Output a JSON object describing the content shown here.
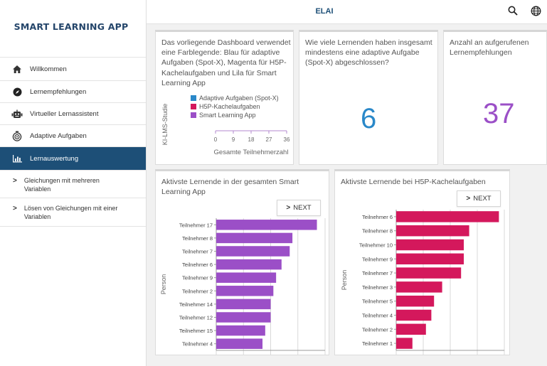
{
  "app_title": "SMART LEARNING APP",
  "topbar": {
    "title": "ELAI"
  },
  "nav": [
    {
      "label": "Willkommen",
      "icon": "home-icon",
      "active": false
    },
    {
      "label": "Lernempfehlungen",
      "icon": "compass-icon",
      "active": false
    },
    {
      "label": "Virtueller Lernassistent",
      "icon": "robot-icon",
      "active": false
    },
    {
      "label": "Adaptive Aufgaben",
      "icon": "target-icon",
      "active": false
    },
    {
      "label": "Lernauswertung",
      "icon": "bar-chart-icon",
      "active": true
    }
  ],
  "subnav": [
    {
      "label": "Gleichungen mit mehreren Variablen"
    },
    {
      "label": "Lösen von Gleichungen mit einer Variablen"
    }
  ],
  "card1": {
    "text": "Das vorliegende Dashboard verwendet eine Farblegende: Blau für adaptive Aufgaben (Spot-X), Magenta für H5P-Kachelaufgaben und Lila für Smart Learning App",
    "legend": [
      {
        "label": "Adaptive Aufgaben (Spot-X)",
        "color": "#2a88c9"
      },
      {
        "label": "H5P-Kachelaufgaben",
        "color": "#d4185c"
      },
      {
        "label": "Smart Learning App",
        "color": "#9b4fc7"
      }
    ],
    "ylabel": "KI-LMS-Studie",
    "xlabel": "Gesamte Teilnehmerzahl",
    "ticks": [
      "0",
      "9",
      "18",
      "27",
      "36"
    ]
  },
  "card2": {
    "text": "Wie viele Lernenden haben insgesamt mindestens eine adaptive Aufgabe (Spot-X) abgeschlossen?",
    "value": "6",
    "color": "#2a88c9"
  },
  "card3": {
    "text": "Anzahl an aufgerufenen Lernempfehlungen",
    "value": "37",
    "color": "#9b4fc7"
  },
  "chart_panel1": {
    "title": "Aktivste Lernende in der gesamten Smart Learning App",
    "next_label": "NEXT"
  },
  "chart_panel2": {
    "title": "Aktivste Lernende bei H5P-Kachelaufgaben",
    "next_label": "NEXT"
  },
  "chart_data": [
    {
      "type": "bar",
      "orientation": "horizontal",
      "title": "Aktivste Lernende in der gesamten Smart Learning App",
      "ylabel": "Person",
      "xlabel": "",
      "categories": [
        "Teilnehmer 17",
        "Teilnehmer 8",
        "Teilnehmer 7",
        "Teilnehmer 6",
        "Teilnehmer 9",
        "Teilnehmer 2",
        "Teilnehmer 14",
        "Teilnehmer 12",
        "Teilnehmer 15",
        "Teilnehmer 4"
      ],
      "values": [
        37,
        28,
        27,
        24,
        22,
        21,
        20,
        20,
        18,
        17
      ],
      "xlim": [
        0,
        40
      ],
      "color": "#9b4fc7",
      "grid": true
    },
    {
      "type": "bar",
      "orientation": "horizontal",
      "title": "Aktivste Lernende bei H5P-Kachelaufgaben",
      "ylabel": "Person",
      "xlabel": "",
      "categories": [
        "Teilnehmer 6",
        "Teilnehmer 8",
        "Teilnehmer 10",
        "Teilnehmer 9",
        "Teilnehmer 7",
        "Teilnehmer 3",
        "Teilnehmer 5",
        "Teilnehmer 4",
        "Teilnehmer 2",
        "Teilnehmer 1"
      ],
      "values": [
        38,
        27,
        25,
        25,
        24,
        17,
        14,
        13,
        11,
        6
      ],
      "xlim": [
        0,
        40
      ],
      "color": "#d4185c",
      "grid": true
    }
  ]
}
